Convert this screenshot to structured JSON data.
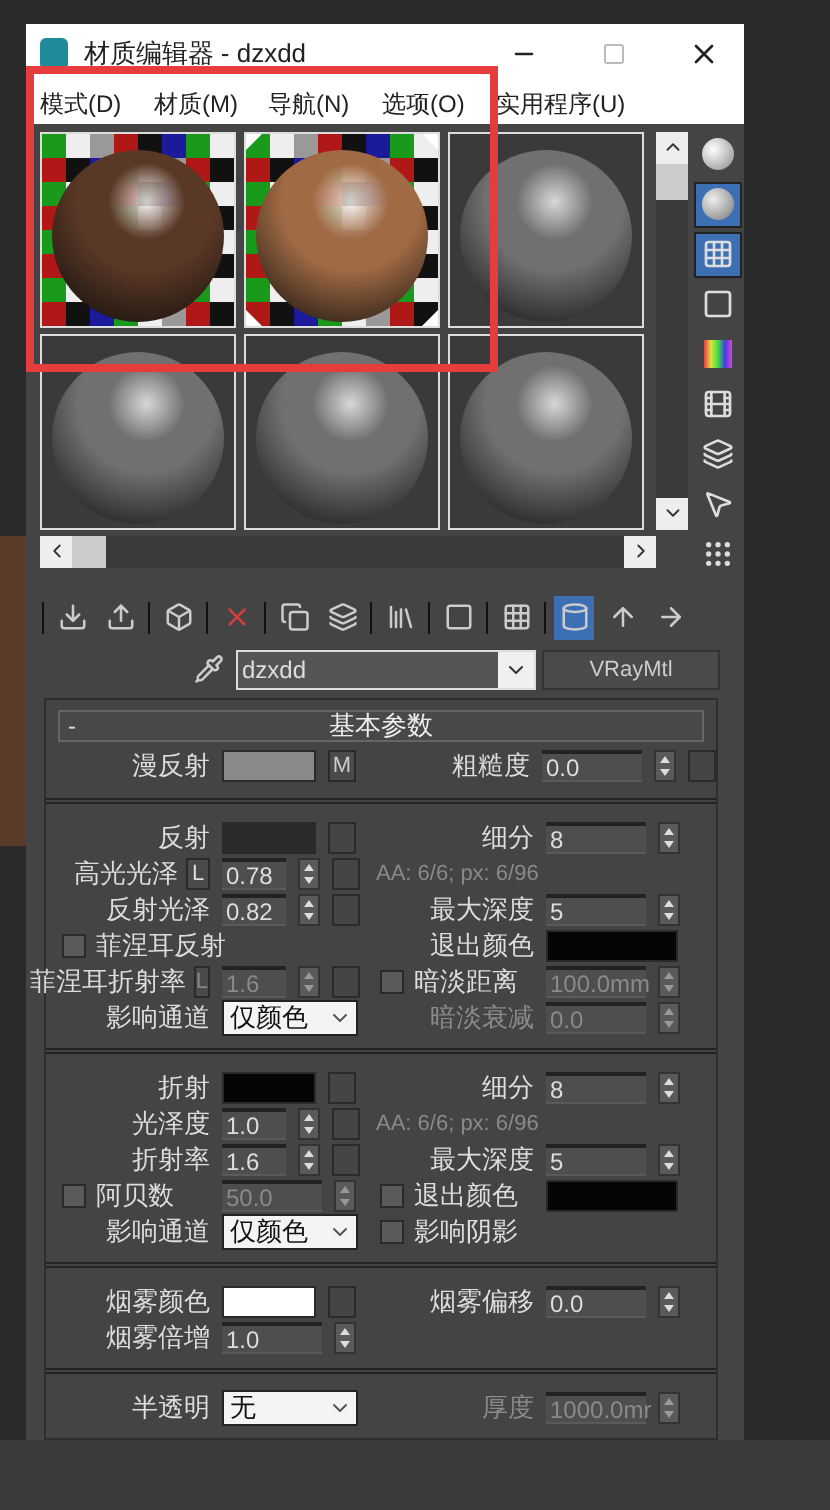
{
  "window": {
    "title": "材质编辑器 - dzxdd"
  },
  "menu": [
    "模式(D)",
    "材质(M)",
    "导航(N)",
    "选项(O)",
    "实用程序(U)"
  ],
  "sample_slots": [
    {
      "kind": "checker",
      "color": "#5a3826",
      "selected": false
    },
    {
      "kind": "checker",
      "color": "#a06a44",
      "selected": true
    },
    {
      "kind": "plain",
      "color": "#707070",
      "selected": false
    },
    {
      "kind": "plain",
      "color": "#707070",
      "selected": false
    },
    {
      "kind": "plain",
      "color": "#707070",
      "selected": false
    },
    {
      "kind": "plain",
      "color": "#707070",
      "selected": false
    }
  ],
  "side_toolbar": [
    {
      "selected": false
    },
    {
      "selected": true
    },
    {
      "selected": true
    },
    {
      "selected": false
    },
    {
      "selected": false
    },
    {
      "selected": false
    },
    {
      "selected": false
    },
    {
      "selected": false
    },
    {
      "selected": false
    }
  ],
  "toolbar": [
    {
      "selected": false
    },
    {
      "selected": false
    },
    {
      "selected": false
    },
    {
      "selected": false
    },
    {
      "selected": false
    },
    {
      "selected": false
    },
    {
      "selected": false
    },
    {
      "selected": false
    },
    {
      "selected": false
    },
    {
      "selected": true
    },
    {
      "selected": false
    },
    {
      "selected": false
    }
  ],
  "material": {
    "name": "dzxdd",
    "type": "VRayMtl"
  },
  "rollout": {
    "toggle": "-",
    "title": "基本参数"
  },
  "sections": [
    {
      "rows": [
        {
          "left": {
            "kind": "color",
            "label": "漫反射",
            "color": "#8a8a8a",
            "map_button": "M"
          },
          "right": {
            "kind": "spinner",
            "label": "粗糙度",
            "value": "0.0",
            "map_slot": true
          }
        }
      ]
    },
    {
      "rows": [
        {
          "left": {
            "kind": "color",
            "label": "反射",
            "color": "#2a2a2a"
          },
          "right": {
            "kind": "spinner",
            "label": "细分",
            "value": "8"
          }
        },
        {
          "left": {
            "kind": "spinner",
            "label": "高光光泽",
            "lock": "L",
            "value": "0.78"
          },
          "right": {
            "kind": "info",
            "text": "AA: 6/6; px: 6/96"
          }
        },
        {
          "left": {
            "kind": "spinner",
            "label": "反射光泽",
            "value": "0.82"
          },
          "right": {
            "kind": "spinner",
            "label": "最大深度",
            "value": "5"
          }
        },
        {
          "left": {
            "kind": "checkbox",
            "label": "菲涅耳反射",
            "checked": false
          },
          "right": {
            "kind": "color",
            "label": "退出颜色",
            "color": "#050505"
          }
        },
        {
          "left": {
            "kind": "spinner",
            "label": "菲涅耳折射率",
            "lock": "L",
            "value": "1.6",
            "disabled": true
          },
          "right": {
            "kind": "checkspinner",
            "label": "暗淡距离",
            "value": "100.0mm",
            "checked": false,
            "disabled": true
          }
        },
        {
          "left": {
            "kind": "dropdown",
            "label": "影响通道",
            "value": "仅颜色"
          },
          "right": {
            "kind": "spinner",
            "label": "暗淡衰减",
            "value": "0.0",
            "disabled": true
          }
        }
      ]
    },
    {
      "rows": [
        {
          "left": {
            "kind": "color",
            "label": "折射",
            "color": "#050505"
          },
          "right": {
            "kind": "spinner",
            "label": "细分",
            "value": "8"
          }
        },
        {
          "left": {
            "kind": "spinner",
            "label": "光泽度",
            "value": "1.0"
          },
          "right": {
            "kind": "info",
            "text": "AA: 6/6; px: 6/96"
          }
        },
        {
          "left": {
            "kind": "spinner",
            "label": "折射率",
            "value": "1.6"
          },
          "right": {
            "kind": "spinner",
            "label": "最大深度",
            "value": "5"
          }
        },
        {
          "left": {
            "kind": "checkspinner",
            "label": "阿贝数",
            "value": "50.0",
            "checked": false,
            "disabled": true
          },
          "right": {
            "kind": "checkcolor",
            "label": "退出颜色",
            "color": "#050505",
            "checked": false
          }
        },
        {
          "left": {
            "kind": "dropdown",
            "label": "影响通道",
            "value": "仅颜色"
          },
          "right": {
            "kind": "checkbox",
            "label": "影响阴影",
            "checked": false
          }
        }
      ]
    },
    {
      "rows": [
        {
          "left": {
            "kind": "color",
            "label": "烟雾颜色",
            "color": "#ffffff"
          },
          "right": {
            "kind": "spinner",
            "label": "烟雾偏移",
            "value": "0.0"
          }
        },
        {
          "left": {
            "kind": "spinner",
            "label": "烟雾倍增",
            "value": "1.0",
            "no_slot": true
          }
        }
      ]
    },
    {
      "rows": [
        {
          "left": {
            "kind": "dropdown",
            "label": "半透明",
            "value": "无"
          },
          "right": {
            "kind": "spinner",
            "label": "厚度",
            "value": "1000.0mr",
            "disabled": true
          }
        }
      ]
    }
  ]
}
